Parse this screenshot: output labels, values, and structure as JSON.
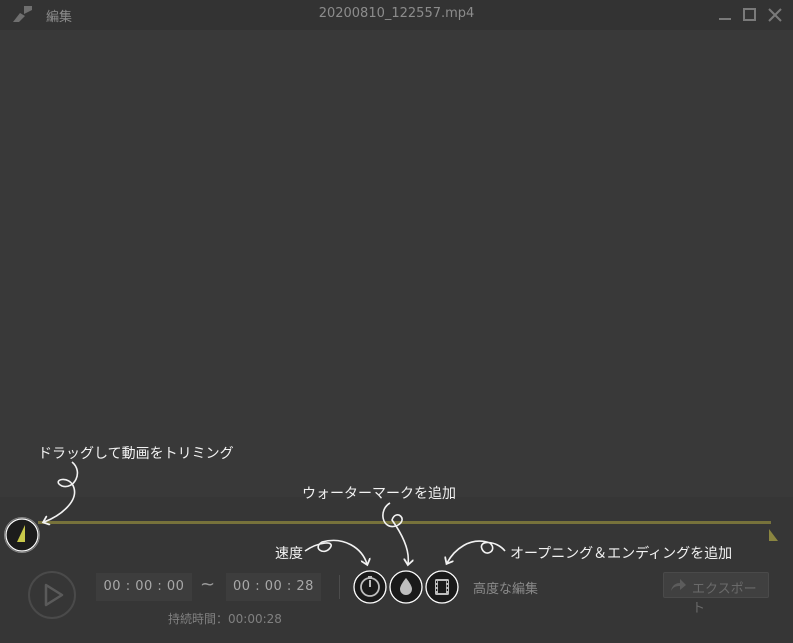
{
  "window": {
    "app_name": "編集",
    "file_title": "20200810_122557.mp4",
    "app_icon": "brush-icon",
    "controls": [
      "minimize-icon",
      "maximize-icon",
      "close-icon"
    ]
  },
  "tips": {
    "trim": "ドラッグして動画をトリミング",
    "watermark": "ウォーターマークを追加",
    "speed": "速度",
    "opening": "オープニング＆エンディングを追加"
  },
  "player": {
    "start_time": "00 : 00 : 00",
    "tilde": "~",
    "end_time": "00 : 00 : 28",
    "duration": "持続時間：00:00:28"
  },
  "tools": {
    "speed_icon": "speedometer-icon",
    "watermark_icon": "drop-icon",
    "opening_icon": "film-icon",
    "advanced": "高度な編集"
  },
  "export": {
    "label": "エクスポート",
    "icon": "share-arrow-icon"
  },
  "colors": {
    "track": "#77723b",
    "handle": "#c8c84a",
    "background": "#3a3a3a"
  }
}
